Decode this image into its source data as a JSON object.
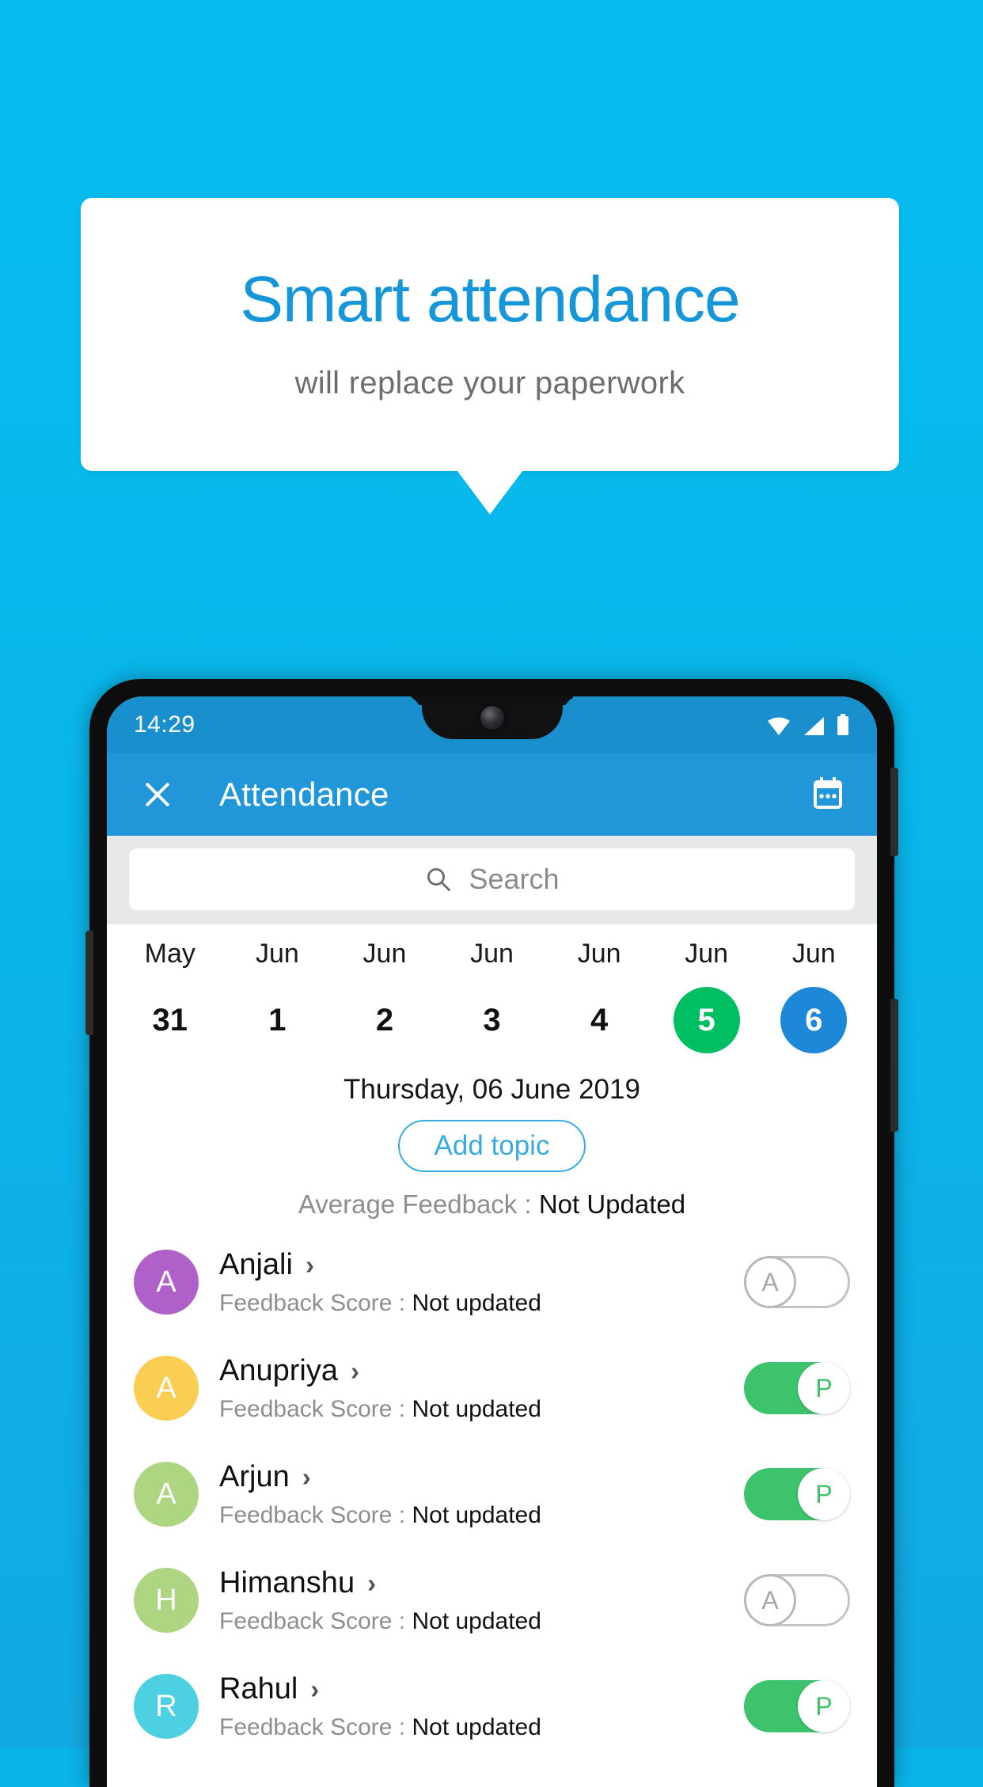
{
  "promo": {
    "title": "Smart attendance",
    "subtitle": "will replace your paperwork",
    "title_color": "#1596d8",
    "background_color": "#09b6ea"
  },
  "statusbar": {
    "time": "14:29",
    "icons": [
      "wifi-icon",
      "signal-icon",
      "battery-icon"
    ]
  },
  "appbar": {
    "close_label": "close-icon",
    "title": "Attendance",
    "calendar_label": "calendar-icon",
    "background_color": "#2196d8"
  },
  "search": {
    "placeholder": "Search",
    "icon": "search-icon"
  },
  "dates": [
    {
      "month": "May",
      "day": "31",
      "state": "normal"
    },
    {
      "month": "Jun",
      "day": "1",
      "state": "normal"
    },
    {
      "month": "Jun",
      "day": "2",
      "state": "normal"
    },
    {
      "month": "Jun",
      "day": "3",
      "state": "normal"
    },
    {
      "month": "Jun",
      "day": "4",
      "state": "normal"
    },
    {
      "month": "Jun",
      "day": "5",
      "state": "green"
    },
    {
      "month": "Jun",
      "day": "6",
      "state": "blue"
    }
  ],
  "date_colors": {
    "green": "#00bf63",
    "blue": "#1e88d8"
  },
  "selected_date_label": "Thursday, 06 June 2019",
  "add_topic_label": "Add topic",
  "average_feedback": {
    "label": "Average Feedback : ",
    "value": "Not Updated"
  },
  "score_label": "Feedback Score : ",
  "students": [
    {
      "name": "Anjali",
      "initial": "A",
      "avatar_color": "#b061c9",
      "score": "Not updated",
      "attendance": "A",
      "present": false
    },
    {
      "name": "Anupriya",
      "initial": "A",
      "avatar_color": "#f9ce52",
      "score": "Not updated",
      "attendance": "P",
      "present": true
    },
    {
      "name": "Arjun",
      "initial": "A",
      "avatar_color": "#aed581",
      "score": "Not updated",
      "attendance": "P",
      "present": true
    },
    {
      "name": "Himanshu",
      "initial": "H",
      "avatar_color": "#aed581",
      "score": "Not updated",
      "attendance": "A",
      "present": false
    },
    {
      "name": "Rahul",
      "initial": "R",
      "avatar_color": "#4dd0e1",
      "score": "Not updated",
      "attendance": "P",
      "present": true
    }
  ]
}
